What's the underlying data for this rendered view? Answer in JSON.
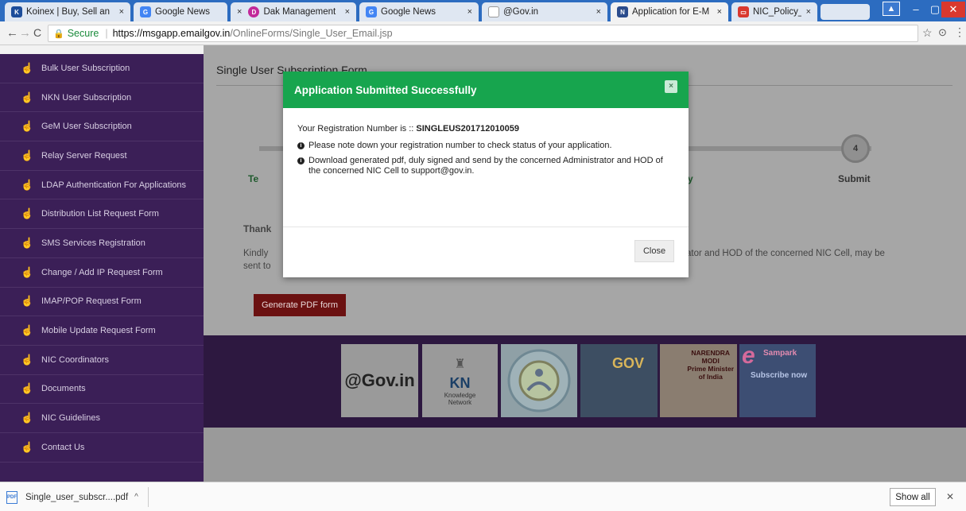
{
  "tabs": [
    {
      "label": "Koinex | Buy, Sell an",
      "close": "×",
      "color": "#1c4d9a"
    },
    {
      "label": "Google News",
      "close": "×",
      "color": "#4285f4"
    },
    {
      "label": "Dak Management",
      "close": "×",
      "color": "#c2299a"
    },
    {
      "label": "Google News",
      "close": "×",
      "color": "#4285f4"
    },
    {
      "label": "@Gov.in",
      "close": "×",
      "color": "#999999"
    },
    {
      "label": "Application for E-M",
      "close": "×",
      "color": "#2b4c8c"
    },
    {
      "label": "NIC_Policy_on_form",
      "close": "×",
      "color": "#d9382e"
    }
  ],
  "window": {
    "min": "–",
    "max": "▢",
    "close": "✕"
  },
  "address": {
    "secure": "Secure",
    "url_host": "https://msgapp.emailgov.in",
    "url_path": "/OnlineForms/Single_User_Email.jsp"
  },
  "sidebar": {
    "items": [
      "Bulk User Subscription",
      "NKN User Subscription",
      "GeM User Subscription",
      "Relay Server Request",
      "LDAP Authentication For Applications",
      "Distribution List Request Form",
      "SMS Services Registration",
      "Change / Add IP Request Form",
      "IMAP/POP Request Form",
      "Mobile Update Request Form",
      "NIC Coordinators",
      "Documents",
      "NIC Guidelines",
      "Contact Us"
    ]
  },
  "main": {
    "form_title": "Single User Subscription Form",
    "step_number": "4",
    "step_terms": "Te",
    "step_y": "y",
    "step_submit": "Submit",
    "thank": "Thank",
    "kindly": "Kindly",
    "sent_to": "sent to",
    "kindly_right": "trator and HOD of the concerned NIC Cell, may be",
    "generate_button": "Generate PDF form"
  },
  "banner": {
    "gov": "@Gov.in",
    "knowledge": "Knowledge",
    "network": "Network",
    "mygov": "GOV",
    "modi_line1": "NARENDRA",
    "modi_line2": "MODI",
    "modi_line3": "Prime Minister",
    "modi_line4": "of India",
    "sampark": "Sampark",
    "subscribe": "Subscribe now"
  },
  "modal": {
    "title": "Application Submitted Successfully",
    "reg_prefix": "Your Registration Number is :: ",
    "reg_number": "SINGLEUS201712010059",
    "note1": "Please note down your registration number to check status of your application.",
    "note2": "Download generated pdf, duly signed and send by the concerned Administrator and HOD of the concerned NIC Cell to support@gov.in.",
    "close_button": "Close",
    "x": "×"
  },
  "download": {
    "file": "Single_user_subscr....pdf",
    "show_all": "Show all"
  },
  "colors": {
    "modal_header": "#17a54e",
    "sidebar": "#3b1f57",
    "generate_btn": "#6b1111"
  }
}
